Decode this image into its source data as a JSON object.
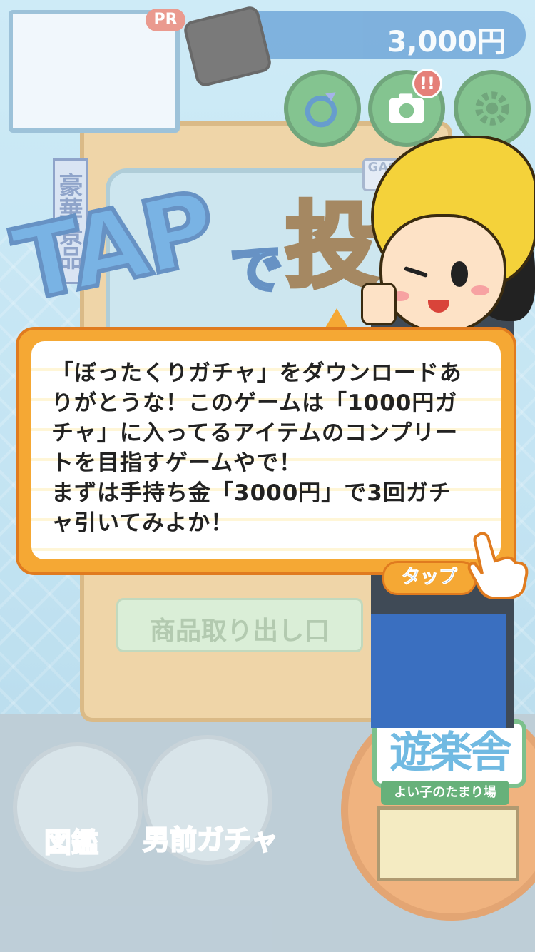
{
  "header": {
    "pr_badge": "PR",
    "money": "3,000円"
  },
  "toolbar": {
    "buttons": [
      {
        "name": "ring-icon"
      },
      {
        "name": "camera-icon",
        "alert": "!!"
      },
      {
        "name": "gear-icon"
      }
    ]
  },
  "machine": {
    "side_banner": "豪華景品",
    "gacha_label": "GACHA PR",
    "tap_text": "TAP",
    "tap_de": "で",
    "tap_kanji": "投",
    "slot_label": "商品取り出し口"
  },
  "dialog": {
    "lines": [
      "「ぼったくりガチャ」をダウンロードあ",
      "りがとうな！このゲームは「1000円ガ",
      "チャ」に入ってるアイテムのコンプリー",
      "トを目指すゲームやで！",
      "まずは手持ち金「3000円」で3回ガチ",
      "ャ引いてみよか！"
    ],
    "tap_button": "タップ"
  },
  "bottom_nav": {
    "zukan": "図鑑",
    "otokomae": "男前ガチャ",
    "yuraku_sign": "遊楽舎",
    "yuraku_sub": "よい子のたまり場"
  },
  "colors": {
    "bubble_border": "#f5a834",
    "money_bar": "#2f7fc7",
    "button_green": "#4aa85c",
    "tap_text": "#1a6fc8"
  }
}
